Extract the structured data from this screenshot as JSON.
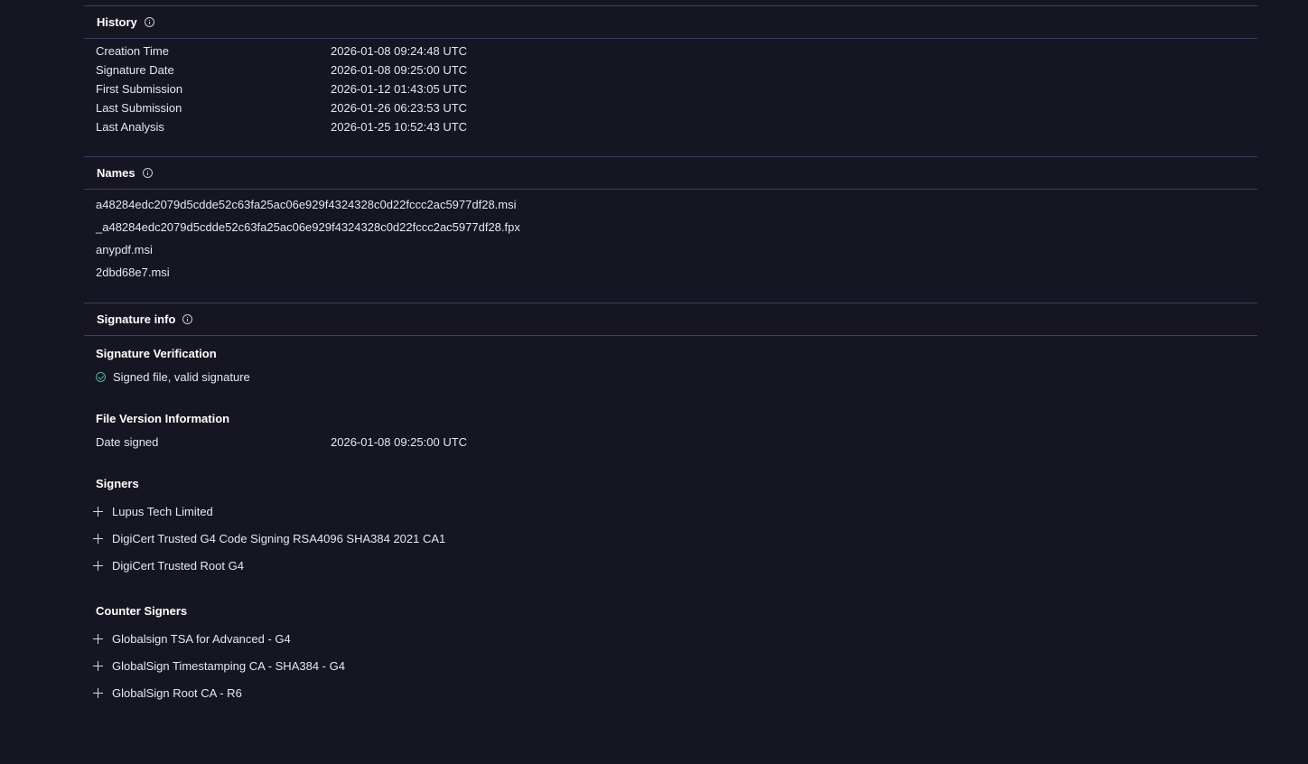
{
  "history": {
    "title": "History",
    "rows": [
      {
        "key": "Creation Time",
        "value": "2026-01-08 09:24:48 UTC"
      },
      {
        "key": "Signature Date",
        "value": "2026-01-08 09:25:00 UTC"
      },
      {
        "key": "First Submission",
        "value": "2026-01-12 01:43:05 UTC"
      },
      {
        "key": "Last Submission",
        "value": "2026-01-26 06:23:53 UTC"
      },
      {
        "key": "Last Analysis",
        "value": "2026-01-25 10:52:43 UTC"
      }
    ]
  },
  "names": {
    "title": "Names",
    "items": [
      "a48284edc2079d5cdde52c63fa25ac06e929f4324328c0d22fccc2ac5977df28.msi",
      "_a48284edc2079d5cdde52c63fa25ac06e929f4324328c0d22fccc2ac5977df28.fpx",
      "anypdf.msi",
      "2dbd68e7.msi"
    ]
  },
  "signature_info": {
    "title": "Signature info",
    "verification": {
      "heading": "Signature Verification",
      "status": "Signed file, valid signature"
    },
    "file_version": {
      "heading": "File Version Information",
      "rows": [
        {
          "key": "Date signed",
          "value": "2026-01-08 09:25:00 UTC"
        }
      ]
    },
    "signers": {
      "heading": "Signers",
      "items": [
        "Lupus Tech Limited",
        "DigiCert Trusted G4 Code Signing RSA4096 SHA384 2021 CA1",
        "DigiCert Trusted Root G4"
      ]
    },
    "counter_signers": {
      "heading": "Counter Signers",
      "items": [
        "Globalsign TSA for Advanced - G4",
        "GlobalSign Timestamping CA - SHA384 - G4",
        "GlobalSign Root CA - R6"
      ]
    }
  },
  "colors": {
    "background": "#161622",
    "divider": "#3b3f5e",
    "text": "#e6e7ee",
    "valid_icon": "#4fb38a"
  }
}
